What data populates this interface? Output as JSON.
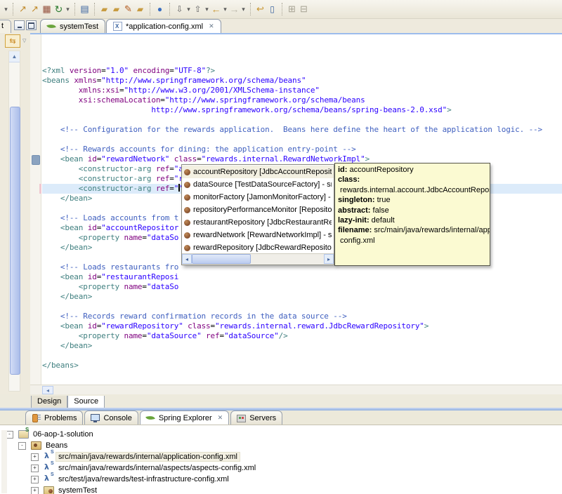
{
  "colors": {
    "toolbar_bg": "#eeebdd",
    "editor_current_line": "#dcebfa",
    "tooltip_bg": "#fbfad2",
    "selection_unfocused": "#f3f0e2",
    "panel_divider_blue": "#8fafe0",
    "syntax": {
      "t": "#3f7f7f",
      "a": "#7f007f",
      "v": "#2a00ff",
      "c": "#3f5fbf",
      "p": "#000000"
    }
  },
  "toolbar": {
    "groups": [
      [
        "dropdown-caret"
      ],
      [
        "wizard-icon-a",
        "wizard-icon-b",
        "java-package-icon",
        "refresh-icon",
        "dropdown-caret"
      ],
      [
        "javadoc-icon"
      ],
      [
        "import-icon",
        "export-icon",
        "brush-icon",
        "folder-icon"
      ],
      [
        "browser-icon"
      ],
      [
        "next-annotation-icon",
        "dropdown-caret",
        "prev-annotation-icon",
        "dropdown-caret",
        "back-icon",
        "dropdown-caret",
        "forward-icon",
        "dropdown-caret"
      ],
      [
        "last-edit-icon",
        "bookmark-icon"
      ],
      [
        "expand-all-icon",
        "collapse-all-icon"
      ]
    ]
  },
  "left_panel": {
    "tab_fragment": "t",
    "link_with_editor_glyph": "⇆",
    "view_menu_glyph": "▽",
    "scroll_up_glyph": "▲"
  },
  "editor_tabs": [
    {
      "label": "systemTest",
      "icon": "spring-leaf-icon",
      "active": false,
      "closable": false
    },
    {
      "label": "*application-config.xml",
      "icon": "xml-file-icon",
      "active": true,
      "closable": true
    }
  ],
  "editor": {
    "current_line": 12,
    "lines": [
      [
        [
          "t",
          "<?xml "
        ],
        [
          "a",
          "version"
        ],
        [
          "p",
          "="
        ],
        [
          "v",
          "\"1.0\""
        ],
        [
          "p",
          " "
        ],
        [
          "a",
          "encoding"
        ],
        [
          "p",
          "="
        ],
        [
          "v",
          "\"UTF-8\""
        ],
        [
          "t",
          "?>"
        ]
      ],
      [
        [
          "t",
          "<beans "
        ],
        [
          "a",
          "xmlns"
        ],
        [
          "p",
          "="
        ],
        [
          "v",
          "\"http://www.springframework.org/schema/beans\""
        ]
      ],
      [
        [
          "p",
          "        "
        ],
        [
          "a",
          "xmlns:xsi"
        ],
        [
          "p",
          "="
        ],
        [
          "v",
          "\"http://www.w3.org/2001/XMLSchema-instance\""
        ]
      ],
      [
        [
          "p",
          "        "
        ],
        [
          "a",
          "xsi:schemaLocation"
        ],
        [
          "p",
          "="
        ],
        [
          "v",
          "\"http://www.springframework.org/schema/beans"
        ]
      ],
      [
        [
          "v",
          "                        http://www.springframework.org/schema/beans/spring-beans-2.0.xsd\""
        ],
        [
          "t",
          ">"
        ]
      ],
      [],
      [
        [
          "c",
          "    <!-- Configuration for the rewards application.  Beans here define the heart of the application logic. -->"
        ]
      ],
      [],
      [
        [
          "c",
          "    <!-- Rewards accounts for dining: the application entry-point -->"
        ]
      ],
      [
        [
          "p",
          "    "
        ],
        [
          "t",
          "<bean "
        ],
        [
          "a",
          "id"
        ],
        [
          "p",
          "="
        ],
        [
          "v",
          "\"rewardNetwork\""
        ],
        [
          "p",
          " "
        ],
        [
          "a",
          "class"
        ],
        [
          "p",
          "="
        ],
        [
          "v",
          "\"rewards.internal.RewardNetworkImpl\""
        ],
        [
          "t",
          ">"
        ]
      ],
      [
        [
          "p",
          "        "
        ],
        [
          "t",
          "<constructor-arg "
        ],
        [
          "a",
          "ref"
        ],
        [
          "p",
          "="
        ],
        [
          "v",
          "\"accountRepository\""
        ],
        [
          "t",
          "/>"
        ]
      ],
      [
        [
          "p",
          "        "
        ],
        [
          "t",
          "<constructor-arg "
        ],
        [
          "a",
          "ref"
        ],
        [
          "p",
          "="
        ],
        [
          "v",
          "\"restaurantRepository\""
        ],
        [
          "t",
          "/>"
        ]
      ],
      [
        [
          "p",
          "        "
        ],
        [
          "t",
          "<constructor-arg "
        ],
        [
          "a",
          "ref"
        ],
        [
          "p",
          "="
        ],
        [
          "v",
          "\""
        ],
        [
          "x",
          ""
        ],
        [
          "v",
          "\""
        ],
        [
          "t",
          "/>"
        ]
      ],
      [
        [
          "p",
          "    "
        ],
        [
          "t",
          "</bean>"
        ]
      ],
      [],
      [
        [
          "c",
          "    <!-- Loads accounts from t"
        ]
      ],
      [
        [
          "p",
          "    "
        ],
        [
          "t",
          "<bean "
        ],
        [
          "a",
          "id"
        ],
        [
          "p",
          "="
        ],
        [
          "v",
          "\"accountRepositor"
        ]
      ],
      [
        [
          "p",
          "        "
        ],
        [
          "t",
          "<property "
        ],
        [
          "a",
          "name"
        ],
        [
          "p",
          "="
        ],
        [
          "v",
          "\"dataSo"
        ]
      ],
      [
        [
          "p",
          "    "
        ],
        [
          "t",
          "</bean>"
        ]
      ],
      [],
      [
        [
          "c",
          "    <!-- Loads restaurants fro"
        ]
      ],
      [
        [
          "p",
          "    "
        ],
        [
          "t",
          "<bean "
        ],
        [
          "a",
          "id"
        ],
        [
          "p",
          "="
        ],
        [
          "v",
          "\"restaurantReposi"
        ]
      ],
      [
        [
          "p",
          "        "
        ],
        [
          "t",
          "<property "
        ],
        [
          "a",
          "name"
        ],
        [
          "p",
          "="
        ],
        [
          "v",
          "\"dataSo"
        ]
      ],
      [
        [
          "p",
          "    "
        ],
        [
          "t",
          "</bean>"
        ]
      ],
      [],
      [
        [
          "c",
          "    <!-- Records reward confirmation records in the data source -->"
        ]
      ],
      [
        [
          "p",
          "    "
        ],
        [
          "t",
          "<bean "
        ],
        [
          "a",
          "id"
        ],
        [
          "p",
          "="
        ],
        [
          "v",
          "\"rewardRepository\""
        ],
        [
          "p",
          " "
        ],
        [
          "a",
          "class"
        ],
        [
          "p",
          "="
        ],
        [
          "v",
          "\"rewards.internal.reward.JdbcRewardRepository\""
        ],
        [
          "t",
          ">"
        ]
      ],
      [
        [
          "p",
          "        "
        ],
        [
          "t",
          "<property "
        ],
        [
          "a",
          "name"
        ],
        [
          "p",
          "="
        ],
        [
          "v",
          "\"dataSource\""
        ],
        [
          "p",
          " "
        ],
        [
          "a",
          "ref"
        ],
        [
          "p",
          "="
        ],
        [
          "v",
          "\"dataSource\""
        ],
        [
          "t",
          "/>"
        ]
      ],
      [
        [
          "p",
          "    "
        ],
        [
          "t",
          "</bean>"
        ]
      ],
      [],
      [
        [
          "t",
          "</beans>"
        ]
      ]
    ]
  },
  "completion_popup": {
    "items": [
      {
        "icon": "bean-icon",
        "label": "accountRepository [JdbcAccountRepository] - src",
        "selected": true
      },
      {
        "icon": "bean-icon",
        "label": "dataSource [TestDataSourceFactory] - src/test/ja",
        "selected": false
      },
      {
        "icon": "bean-icon",
        "label": "monitorFactory [JamonMonitorFactory] - src/main",
        "selected": false
      },
      {
        "icon": "bean-icon",
        "label": "repositoryPerformanceMonitor [RepositoryPerform",
        "selected": false
      },
      {
        "icon": "bean-icon",
        "label": "restaurantRepository [JdbcRestaurantRepository",
        "selected": false
      },
      {
        "icon": "bean-icon",
        "label": "rewardNetwork [RewardNetworkImpl] - src/main/j",
        "selected": false
      },
      {
        "icon": "bean-icon",
        "label": "rewardRepository [JdbcRewardRepository] - src/r",
        "selected": false
      }
    ]
  },
  "bean_tooltip": {
    "rows": [
      {
        "label": "id:",
        "value": "accountRepository"
      },
      {
        "label": "class:",
        "value": ""
      },
      {
        "label": "",
        "value": " rewards.internal.account.JdbcAccountRepository"
      },
      {
        "label": "singleton:",
        "value": "true"
      },
      {
        "label": "abstract:",
        "value": "false"
      },
      {
        "label": "lazy-init:",
        "value": "default"
      },
      {
        "label": "filename:",
        "value": "src/main/java/rewards/internal/application-"
      },
      {
        "label": "",
        "value": " config.xml"
      }
    ]
  },
  "editor_bottom_tabs": [
    {
      "label": "Design",
      "active": false
    },
    {
      "label": "Source",
      "active": true
    }
  ],
  "views": {
    "tabs": [
      {
        "label": "Problems",
        "icon": "problems-icon",
        "active": false,
        "closable": false
      },
      {
        "label": "Console",
        "icon": "console-icon",
        "active": false,
        "closable": false
      },
      {
        "label": "Spring Explorer",
        "icon": "spring-leaf-icon",
        "active": true,
        "closable": true
      },
      {
        "label": "Servers",
        "icon": "servers-icon",
        "active": false,
        "closable": false
      }
    ]
  },
  "tree": {
    "rows": [
      {
        "depth": 0,
        "expander": "minus",
        "icon": "spring-project-icon",
        "label": "06-aop-1-solution",
        "selected": false
      },
      {
        "depth": 1,
        "expander": "minus",
        "icon": "beans-folder-icon",
        "label": "Beans",
        "selected": false
      },
      {
        "depth": 2,
        "expander": "plus",
        "icon": "spring-config-icon",
        "label": "src/main/java/rewards/internal/application-config.xml",
        "selected": true
      },
      {
        "depth": 2,
        "expander": "plus",
        "icon": "spring-config-icon",
        "label": "src/main/java/rewards/internal/aspects/aspects-config.xml",
        "selected": false
      },
      {
        "depth": 2,
        "expander": "plus",
        "icon": "spring-config-icon",
        "label": "src/test/java/rewards/test-infrastructure-config.xml",
        "selected": false
      },
      {
        "depth": 2,
        "expander": "plus",
        "icon": "systemtest-icon",
        "label": "systemTest",
        "selected": false
      }
    ]
  }
}
